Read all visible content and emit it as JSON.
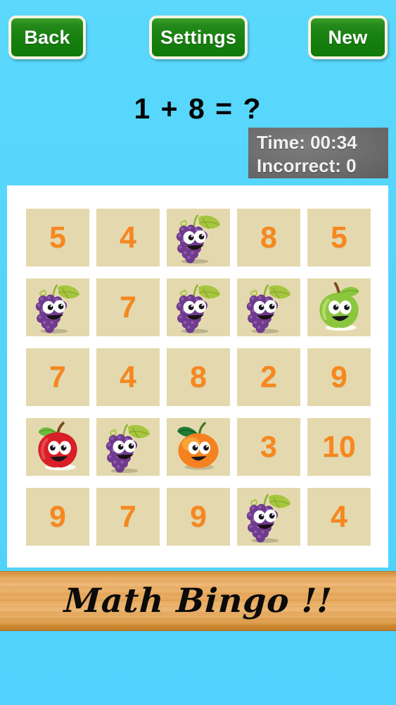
{
  "app": {
    "title": "Math Bingo !!",
    "background_color": "#53d4fb"
  },
  "toolbar": {
    "back_label": "Back",
    "settings_label": "Settings",
    "new_label": "New",
    "button_color": "#17800f",
    "button_border_color": "#f7f3df"
  },
  "question": {
    "equation": "1 + 8 = ?",
    "operand_a": "1",
    "operator": "+",
    "operand_b": "8",
    "answer_placeholder": "?"
  },
  "status": {
    "time_label": "Time: 00:34",
    "incorrect_label": "Incorrect: 0",
    "time_value": "00:34",
    "incorrect_value": "0",
    "panel_color": "#6b6b6b"
  },
  "board": {
    "cell_color": "#e4d9ae",
    "number_color": "#f7871f",
    "rows": 5,
    "columns": 5,
    "cells": [
      {
        "type": "number",
        "value": "5"
      },
      {
        "type": "number",
        "value": "4"
      },
      {
        "type": "fruit",
        "value": "grapes"
      },
      {
        "type": "number",
        "value": "8"
      },
      {
        "type": "number",
        "value": "5"
      },
      {
        "type": "fruit",
        "value": "grapes"
      },
      {
        "type": "number",
        "value": "7"
      },
      {
        "type": "fruit",
        "value": "grapes"
      },
      {
        "type": "fruit",
        "value": "grapes"
      },
      {
        "type": "fruit",
        "value": "green-apple"
      },
      {
        "type": "number",
        "value": "7"
      },
      {
        "type": "number",
        "value": "4"
      },
      {
        "type": "number",
        "value": "8"
      },
      {
        "type": "number",
        "value": "2"
      },
      {
        "type": "number",
        "value": "9"
      },
      {
        "type": "fruit",
        "value": "red-apple"
      },
      {
        "type": "fruit",
        "value": "grapes"
      },
      {
        "type": "fruit",
        "value": "orange"
      },
      {
        "type": "number",
        "value": "3"
      },
      {
        "type": "number",
        "value": "10"
      },
      {
        "type": "number",
        "value": "9"
      },
      {
        "type": "number",
        "value": "7"
      },
      {
        "type": "number",
        "value": "9"
      },
      {
        "type": "fruit",
        "value": "grapes"
      },
      {
        "type": "number",
        "value": "4"
      }
    ]
  },
  "banner": {
    "title": "Math Bingo !!",
    "wood_color": "#e4a658"
  }
}
